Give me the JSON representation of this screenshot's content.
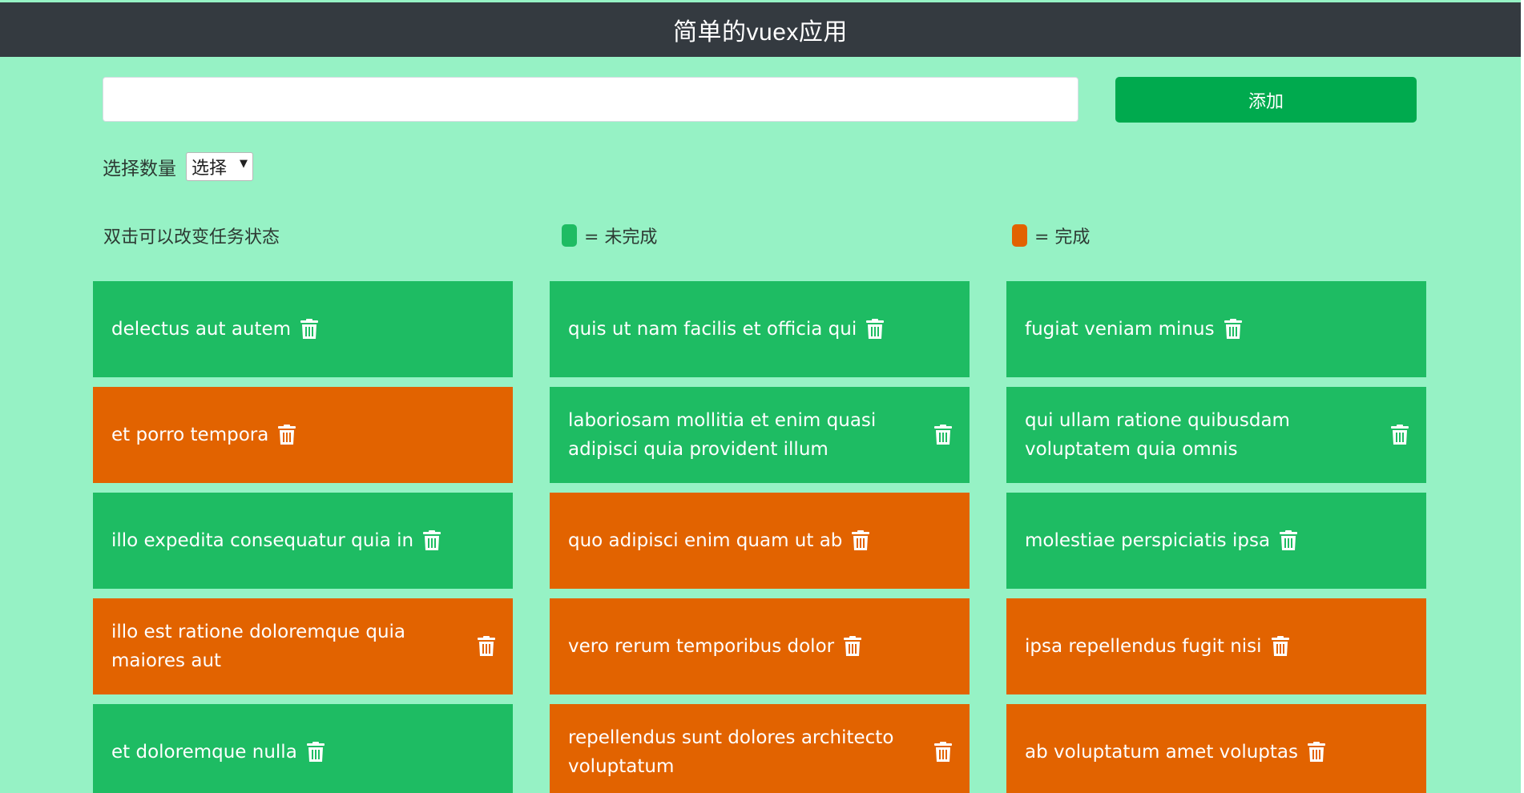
{
  "header": {
    "title": "简单的vuex应用"
  },
  "add_form": {
    "input_value": "",
    "input_placeholder": "",
    "add_label": "添加"
  },
  "filter": {
    "label": "选择数量",
    "selected": "选择"
  },
  "legend": {
    "hint": "双击可以改变任务状态",
    "incomplete_label": "= 未完成",
    "complete_label": "= 完成",
    "incomplete_color": "#1ebc63",
    "complete_color": "#e26300"
  },
  "todos": [
    {
      "title": "delectus aut autem",
      "completed": false
    },
    {
      "title": "quis ut nam facilis et officia qui",
      "completed": false
    },
    {
      "title": "fugiat veniam minus",
      "completed": false
    },
    {
      "title": "et porro tempora",
      "completed": true
    },
    {
      "title": "laboriosam mollitia et enim quasi adipisci quia provident illum",
      "completed": false
    },
    {
      "title": "qui ullam ratione quibusdam voluptatem quia omnis",
      "completed": false
    },
    {
      "title": "illo expedita consequatur quia in",
      "completed": false
    },
    {
      "title": "quo adipisci enim quam ut ab",
      "completed": true
    },
    {
      "title": "molestiae perspiciatis ipsa",
      "completed": false
    },
    {
      "title": "illo est ratione doloremque quia maiores aut",
      "completed": true
    },
    {
      "title": "vero rerum temporibus dolor",
      "completed": true
    },
    {
      "title": "ipsa repellendus fugit nisi",
      "completed": true
    },
    {
      "title": "et doloremque nulla",
      "completed": false
    },
    {
      "title": "repellendus sunt dolores architecto voluptatum",
      "completed": true
    },
    {
      "title": "ab voluptatum amet voluptas",
      "completed": true
    }
  ],
  "icons": {
    "delete": "trash-icon"
  }
}
